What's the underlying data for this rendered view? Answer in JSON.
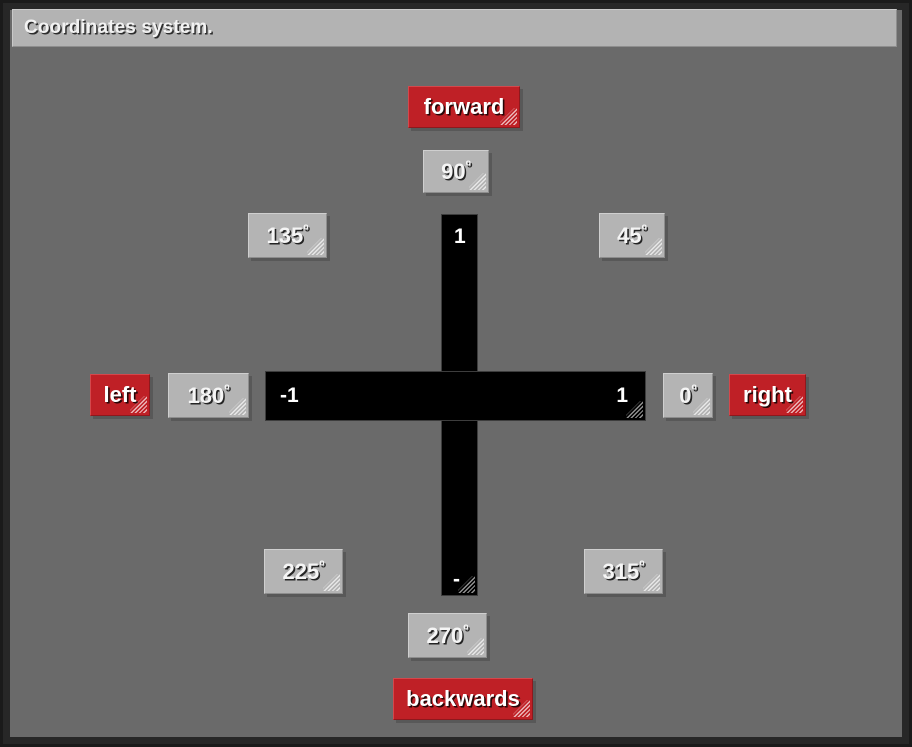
{
  "window": {
    "title": "Coordinates system."
  },
  "colors": {
    "direction_chip_bg": "#bf2026",
    "degree_chip_bg": "#b4b4b4",
    "axis_bar": "#000000",
    "grid_bg": "#6b6b6b",
    "frame": "#272727",
    "title_bar_bg": "#b3b3b3"
  },
  "axes": {
    "vertical": {
      "top_value": "1",
      "bottom_value": "-"
    },
    "horizontal": {
      "left_value": "-1",
      "right_value": "1"
    }
  },
  "directions": [
    {
      "id": "forward",
      "label": "forward"
    },
    {
      "id": "left",
      "label": "left"
    },
    {
      "id": "right",
      "label": "right"
    },
    {
      "id": "backwards",
      "label": "backwards"
    }
  ],
  "angles": [
    {
      "id": "deg-90",
      "value": "90",
      "unit": "º"
    },
    {
      "id": "deg-135",
      "value": "135",
      "unit": "º"
    },
    {
      "id": "deg-45",
      "value": "45",
      "unit": "º"
    },
    {
      "id": "deg-180",
      "value": "180",
      "unit": "º"
    },
    {
      "id": "deg-0",
      "value": "0",
      "unit": "º"
    },
    {
      "id": "deg-225",
      "value": "225",
      "unit": "º"
    },
    {
      "id": "deg-315",
      "value": "315",
      "unit": "º"
    },
    {
      "id": "deg-270",
      "value": "270",
      "unit": "º"
    }
  ]
}
